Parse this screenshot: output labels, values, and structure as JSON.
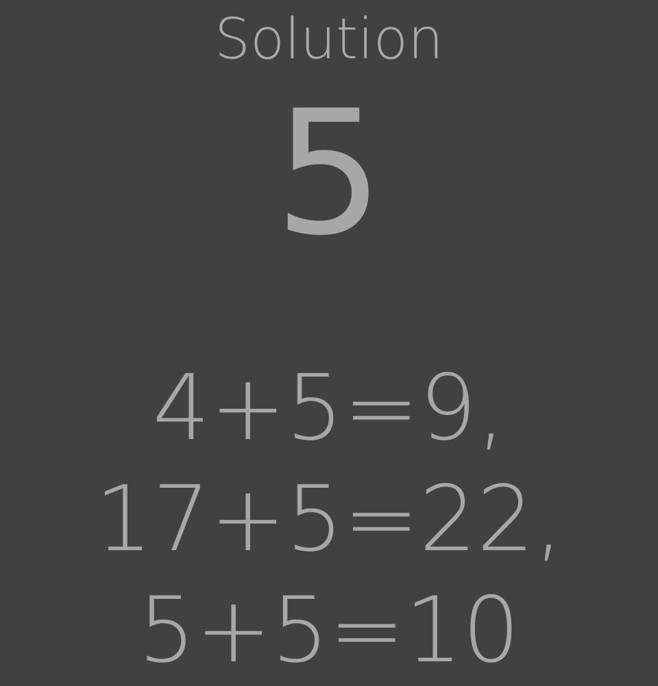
{
  "title": "Solution",
  "answer": "5",
  "equations": [
    "4+5=9,",
    "17+5=22,",
    "5+5=10"
  ],
  "colors": {
    "background": "#414141",
    "text": "#a6a8a8"
  }
}
